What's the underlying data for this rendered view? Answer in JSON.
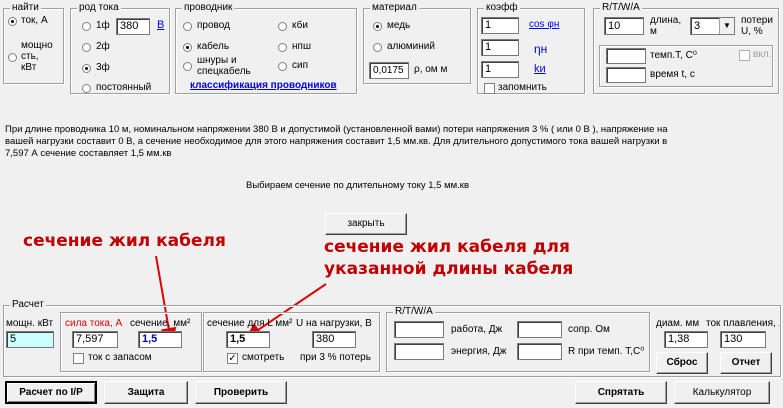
{
  "find_group": {
    "label": "найти",
    "options": [
      "ток, А",
      "мощно\nсть,\nкВт"
    ],
    "selected": 0
  },
  "current_type": {
    "label": "род тока",
    "options": [
      "1ф",
      "2ф",
      "3ф",
      "постоянный"
    ],
    "selected": 2,
    "voltage": "380",
    "voltage_unit": "В"
  },
  "conductor": {
    "label": "проводник",
    "options": [
      "провод",
      "кабель",
      "шнуры и\nспецкабель",
      "кби",
      "нпш",
      "сип"
    ],
    "selected": 1,
    "classification_link": "классификация проводников"
  },
  "material": {
    "label": "материал",
    "options": [
      "медь",
      "алюминий"
    ],
    "selected": 0,
    "resistivity": "0,0175",
    "resistivity_unit": "ρ, ом м"
  },
  "coeff": {
    "label": "коэфф",
    "values": [
      "1",
      "1",
      "1"
    ],
    "labels": [
      "cos φн",
      "ηн",
      "kи"
    ],
    "remember_label": "запомнить"
  },
  "rtwa_top": {
    "label": "R/T/W/A",
    "length_value": "10",
    "length_label": "длина,\nм",
    "dropdown_value": "3",
    "loss_label": "потери\nU, %",
    "temp_label": "темп.T, C⁰",
    "time_label": "время t, c",
    "enable_label": "вкл."
  },
  "info": {
    "paragraph": "При длине проводника 10 м, номинальном напряжении 380 В и допустимой (установленной вами) потери напряжения 3 % ( или 0 В ), напряжение на вашей нагрузки составит 0 В, а сечение необходимое для этого напряжения составит 1,5 мм.кв. Для длительного допустимого тока вашей нагрузки в 7,597 А сечение составляет 1,5 мм.кв",
    "summary": "Выбираем сечение по длительному току 1,5 мм.кв",
    "close_button": "закрыть"
  },
  "annotations": {
    "left": "сечение жил кабеля",
    "right_line1": "сечение жил кабеля для",
    "right_line2": "указанной длины кабеля"
  },
  "calc": {
    "label": "Расчет",
    "power_label": "мощн. кВт",
    "power_value": "5",
    "current_label": "сила тока, А",
    "current_value": "7,597",
    "section_label": "сечение, мм²",
    "section_value": "1,5",
    "reserve_label": "ток с запасом",
    "section_l_label": "сечение для L мм²",
    "section_l_value": "1,5",
    "u_load_label": "U на нагрузки, В",
    "u_load_value": "380",
    "watch_label": "смотреть",
    "loss_note": "при 3 % потерь",
    "rtwa_label": "R/T/W/A",
    "work_label": "работа, Дж",
    "energy_label": "энергия, Дж",
    "resist_label": "сопр. Ом",
    "resist_temp_label": "R при темп. T,С⁰",
    "diam_label": "диам. мм",
    "diam_value": "1,38",
    "melt_label": "ток плавления, А",
    "melt_value": "130",
    "reset_button": "Сброс",
    "report_button": "Отчет"
  },
  "bottom": {
    "calc_ip": "Расчет по I/P",
    "protect": "Защита",
    "check": "Проверить",
    "hide": "Спрятать",
    "calculator": "Калькулятор"
  }
}
